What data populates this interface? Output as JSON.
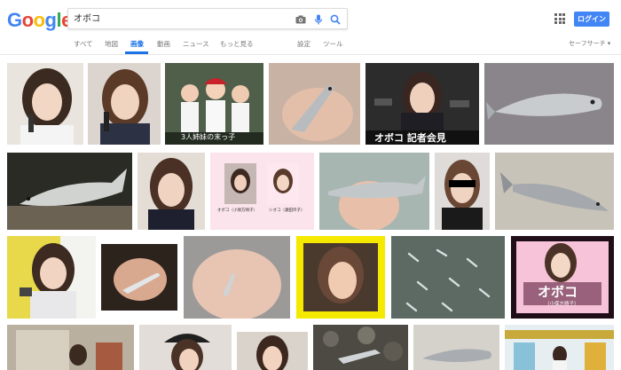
{
  "logo": {
    "letters": [
      "G",
      "o",
      "o",
      "g",
      "l",
      "e"
    ],
    "colors": [
      "#4285f4",
      "#ea4335",
      "#fbbc05",
      "#4285f4",
      "#34a853",
      "#ea4335"
    ]
  },
  "search": {
    "query": "オボコ"
  },
  "header": {
    "login_label": "ログイン"
  },
  "tabs": [
    {
      "label": "すべて"
    },
    {
      "label": "地図"
    },
    {
      "label": "画像"
    },
    {
      "label": "動画"
    },
    {
      "label": "ニュース"
    },
    {
      "label": "もっと見る"
    },
    {
      "label": "設定"
    },
    {
      "label": "ツール"
    }
  ],
  "safe_search_label": "セーフサーチ ▾",
  "accent_color": "#1a73e8",
  "results": [
    {
      "caption": "",
      "kind": "person"
    },
    {
      "caption": "",
      "kind": "person"
    },
    {
      "caption": "3人姉妹の末っ子",
      "kind": "photo-kids"
    },
    {
      "caption": "",
      "kind": "fish-hand"
    },
    {
      "caption": "オボコ 記者会見",
      "kind": "press"
    },
    {
      "caption": "",
      "kind": "fish"
    },
    {
      "caption": "",
      "kind": "fish-dark"
    },
    {
      "caption": "",
      "kind": "person"
    },
    {
      "caption_left": "オボコ（小保方晴子）",
      "caption_right": "シオコ（瀬田玲子）",
      "kind": "two-portraits"
    },
    {
      "caption": "",
      "kind": "fish-hand"
    },
    {
      "caption": "",
      "kind": "person-censored"
    },
    {
      "caption": "",
      "kind": "fish"
    },
    {
      "caption": "",
      "kind": "person-yellow"
    },
    {
      "caption": "",
      "kind": "fish-hand"
    },
    {
      "caption": "",
      "kind": "fish-hand"
    },
    {
      "caption": "",
      "kind": "person-yellow-frame"
    },
    {
      "caption": "",
      "kind": "fish-school"
    },
    {
      "caption": "オボコ",
      "subcaption": "（小保方晴子）",
      "kind": "title-card"
    },
    {
      "caption": "",
      "kind": "building"
    },
    {
      "caption": "",
      "kind": "person-hat"
    },
    {
      "caption": "",
      "kind": "person"
    },
    {
      "caption": "",
      "kind": "rocks"
    },
    {
      "caption": "",
      "kind": "fish"
    },
    {
      "caption": "",
      "kind": "lab"
    }
  ]
}
